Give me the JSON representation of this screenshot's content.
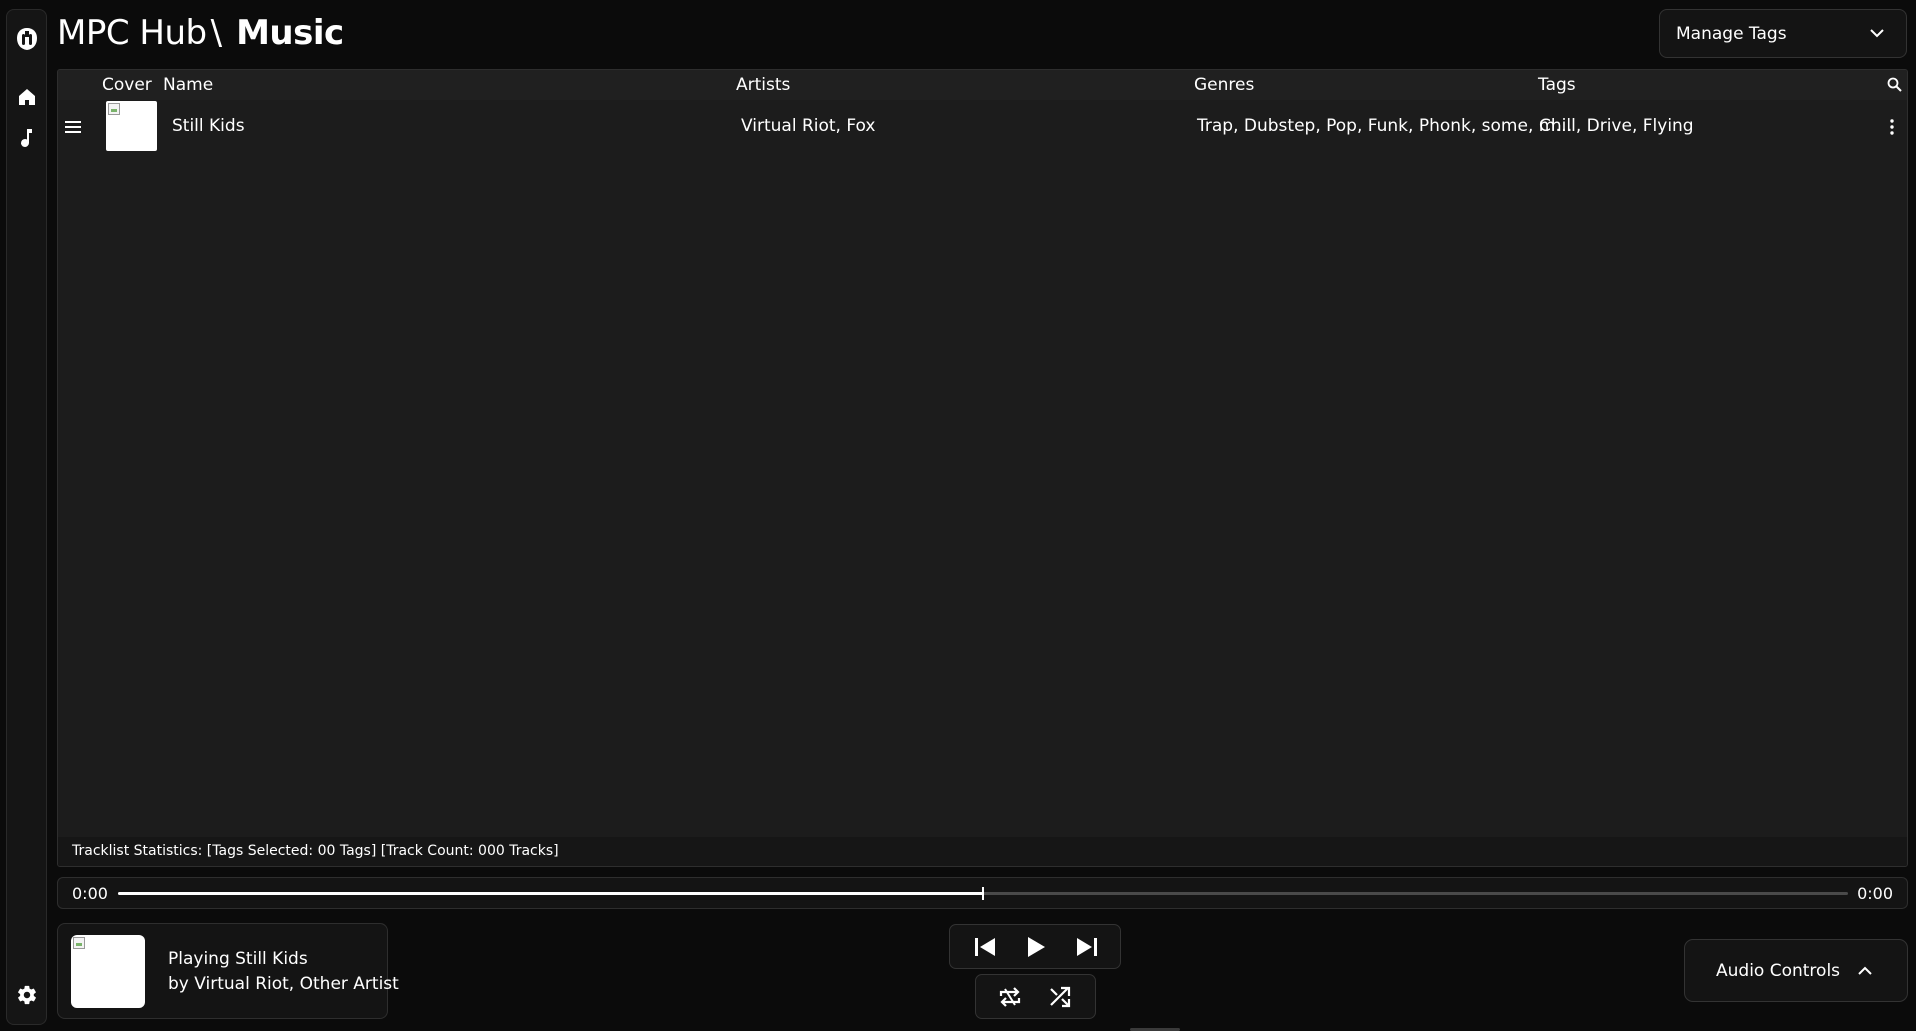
{
  "app": {
    "name": "MPC Hub",
    "separator": "\\",
    "section": "Music"
  },
  "sidebar": {
    "icons": [
      "logo-icon",
      "home-icon",
      "music-note-icon",
      "settings-gear-icon"
    ]
  },
  "header": {
    "manage_tags_label": "Manage Tags"
  },
  "table": {
    "columns": {
      "cover": "Cover",
      "name": "Name",
      "artists": "Artists",
      "genres": "Genres",
      "tags": "Tags"
    },
    "rows": [
      {
        "name": "Still Kids",
        "artists": "Virtual Riot, Fox",
        "genres": "Trap, Dubstep, Pop, Funk, Phonk, some, m…",
        "tags": "Chill, Drive, Flying"
      }
    ],
    "statistics": "Tracklist Statistics: [Tags Selected: 00 Tags] [Track Count: 000 Tracks]"
  },
  "player": {
    "current_time": "0:00",
    "total_time": "0:00",
    "progress_fraction": 0.5,
    "now_playing_line1": "Playing Still Kids",
    "now_playing_line2": "by Virtual Riot, Other Artist",
    "audio_controls_label": "Audio Controls"
  },
  "colors": {
    "background": "#0b0b0b",
    "panel": "#1c1c1c",
    "text": "#ffffff",
    "border": "#2e2e2e"
  }
}
